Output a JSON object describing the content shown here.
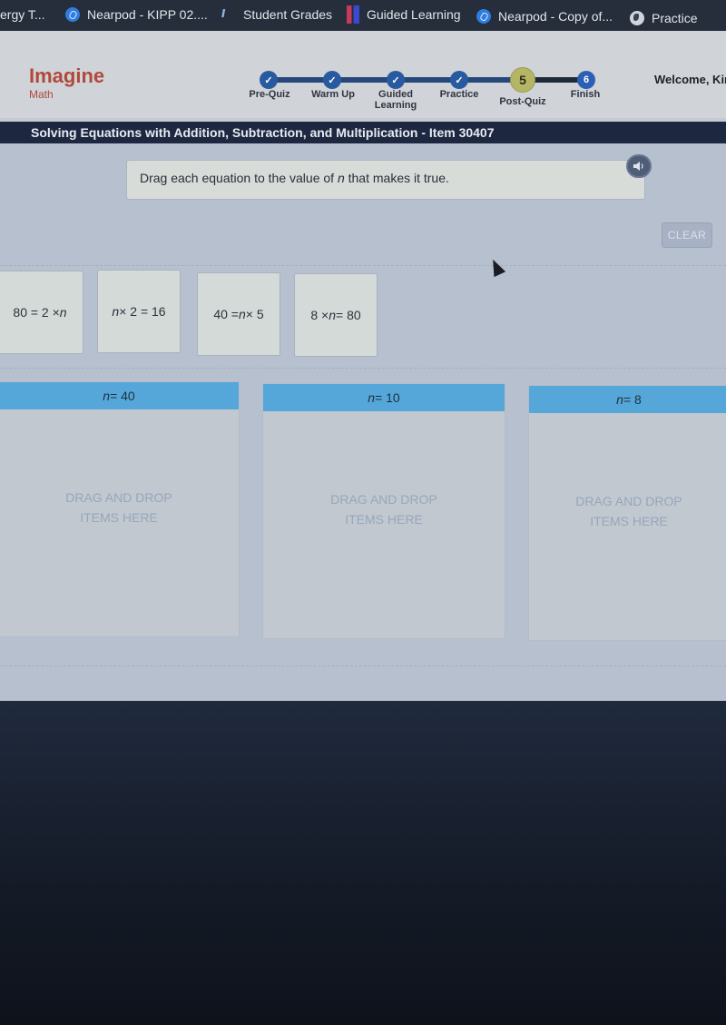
{
  "bookmarks": [
    {
      "label": "ergy T...",
      "icon": "none"
    },
    {
      "label": "Nearpod - KIPP 02....",
      "icon": "nearpod-icon"
    },
    {
      "label": "Student Grades",
      "icon": "grades-icon"
    },
    {
      "label": "Guided Learning",
      "icon": "imagine-learning-icon"
    },
    {
      "label": "Nearpod - Copy of...",
      "icon": "nearpod-icon"
    },
    {
      "label": "Practice",
      "icon": "globe-icon"
    }
  ],
  "header": {
    "logo_title": "Imagine",
    "logo_subtitle": "Math",
    "welcome": "Welcome, Kim",
    "brand_color": "#b0493c"
  },
  "progress": {
    "steps": [
      {
        "label": "Pre-Quiz",
        "status": "complete",
        "marker": "✓"
      },
      {
        "label": "Warm Up",
        "status": "complete",
        "marker": "✓"
      },
      {
        "label": "Guided Learning",
        "status": "complete",
        "marker": "✓"
      },
      {
        "label": "Practice",
        "status": "complete",
        "marker": "✓"
      },
      {
        "label": "Post-Quiz",
        "status": "current",
        "marker": "5"
      },
      {
        "label": "Finish",
        "status": "upcoming",
        "marker": "6"
      }
    ]
  },
  "lesson": {
    "title": "Solving Equations with Addition, Subtraction, and Multiplication - Item 30407"
  },
  "question": {
    "prompt_before": "Drag each equation to the value of ",
    "prompt_var": "n",
    "prompt_after": " that makes it true.",
    "audio_icon": "speaker-icon",
    "clear_label": "CLEAR"
  },
  "cards": [
    {
      "text": "80 = 2 × n"
    },
    {
      "text": "n × 2 = 16"
    },
    {
      "text": "40 = n × 5"
    },
    {
      "text": "8 × n = 80"
    }
  ],
  "zones": [
    {
      "label": "n = 40",
      "placeholder": "DRAG AND DROP ITEMS HERE"
    },
    {
      "label": "n = 10",
      "placeholder": "DRAG AND DROP ITEMS HERE"
    },
    {
      "label": "n = 8",
      "placeholder": "DRAG AND DROP ITEMS HERE"
    }
  ]
}
